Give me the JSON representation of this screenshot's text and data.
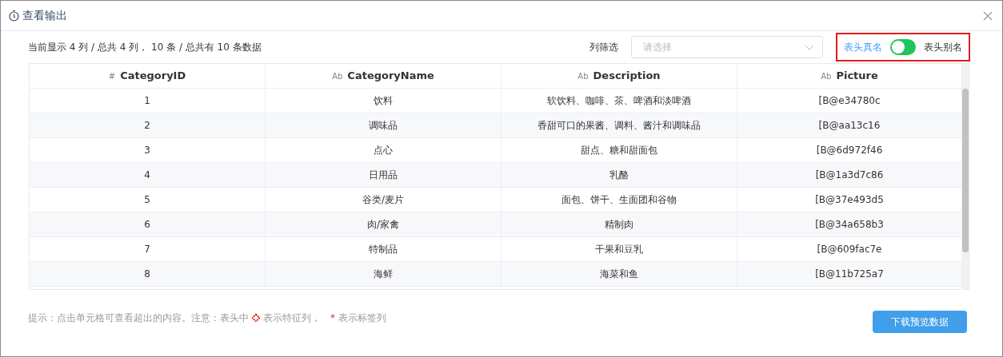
{
  "dialog": {
    "title": "查看输出"
  },
  "summary": "当前显示 4 列 / 总共 4 列， 10 条 / 总共有 10 条数据",
  "column_filter": {
    "label": "列筛选",
    "placeholder": "请选择"
  },
  "header_toggle": {
    "left_label": "表头真名",
    "right_label": "表头别名",
    "real_name_selected": true,
    "highlighted": true
  },
  "table": {
    "columns": [
      {
        "type_mark": "#",
        "name": "CategoryID"
      },
      {
        "type_mark": "Ab",
        "name": "CategoryName"
      },
      {
        "type_mark": "Ab",
        "name": "Description"
      },
      {
        "type_mark": "Ab",
        "name": "Picture"
      }
    ],
    "rows": [
      [
        "1",
        "饮料",
        "软饮料、咖啡、茶、啤酒和淡啤酒",
        "[B@e34780c"
      ],
      [
        "2",
        "调味品",
        "香甜可口的果酱、调料、酱汁和调味品",
        "[B@aa13c16"
      ],
      [
        "3",
        "点心",
        "甜点、糖和甜面包",
        "[B@6d972f46"
      ],
      [
        "4",
        "日用品",
        "乳酪",
        "[B@1a3d7c86"
      ],
      [
        "5",
        "谷类/麦片",
        "面包、饼干、生面团和谷物",
        "[B@37e493d5"
      ],
      [
        "6",
        "肉/家禽",
        "精制肉",
        "[B@34a658b3"
      ],
      [
        "7",
        "特制品",
        "干果和豆乳",
        "[B@609fac7e"
      ],
      [
        "8",
        "海鲜",
        "海菜和鱼",
        "[B@11b725a7"
      ]
    ]
  },
  "hint": {
    "before_icon": "提示：点击单元格可查看超出的内容。注意：表头中",
    "after_icon": "表示特征列，",
    "star": "*",
    "after_star": "表示标签列"
  },
  "download_button": "下载预览数据"
}
